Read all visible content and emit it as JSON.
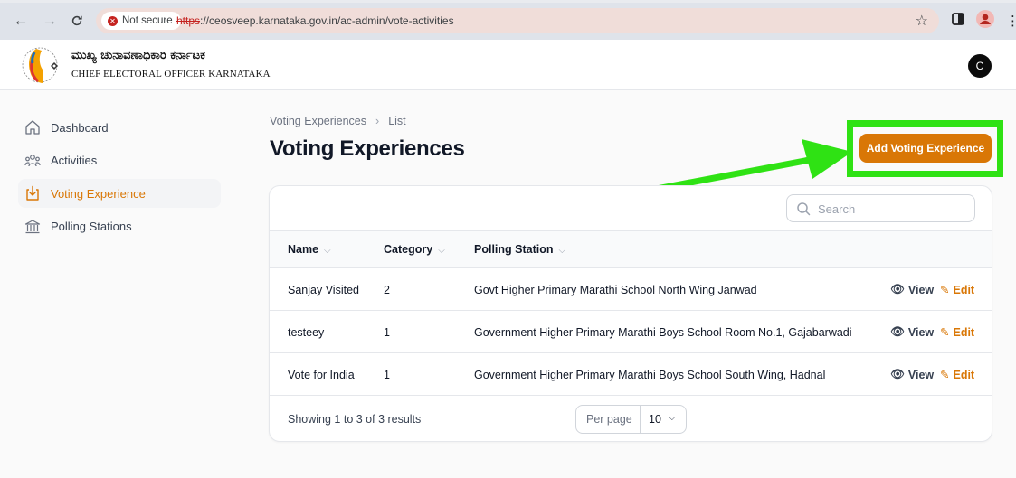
{
  "browser": {
    "security_chip": "Not secure",
    "url_protocol": "https",
    "url_rest": "://ceosveep.karnataka.gov.in/ac-admin/vote-activities",
    "icons": [
      "back-icon",
      "forward-icon",
      "reload-icon",
      "star-icon",
      "side-panel-icon",
      "profile-icon",
      "kebab-menu-icon"
    ]
  },
  "header": {
    "brand_kannada": "ಮುಖ್ಯ ಚುನಾವಣಾಧಿಕಾರಿ ಕರ್ನಾಟಕ",
    "brand_english": "CHIEF ELECTORAL OFFICER KARNATAKA",
    "avatar_initial": "C"
  },
  "sidebar": {
    "items": [
      {
        "label": "Dashboard",
        "icon": "home-icon",
        "active": false
      },
      {
        "label": "Activities",
        "icon": "users-icon",
        "active": false
      },
      {
        "label": "Voting Experience",
        "icon": "inbox-download-icon",
        "active": true
      },
      {
        "label": "Polling Stations",
        "icon": "building-icon",
        "active": false
      }
    ]
  },
  "page": {
    "breadcrumb": [
      "Voting Experiences",
      "List"
    ],
    "title": "Voting Experiences",
    "add_button": "Add Voting Experience"
  },
  "table": {
    "search_placeholder": "Search",
    "columns": [
      "Name",
      "Category",
      "Polling Station"
    ],
    "rows": [
      {
        "name": "Sanjay Visited",
        "category": "2",
        "polling_station": "Govt Higher Primary Marathi School North Wing Janwad"
      },
      {
        "name": "testeey",
        "category": "1",
        "polling_station": "Government Higher Primary Marathi Boys School Room No.1, Gajabarwadi"
      },
      {
        "name": "Vote for India",
        "category": "1",
        "polling_station": "Government Higher Primary Marathi Boys School South Wing, Hadnal"
      }
    ],
    "action_view": "View",
    "action_edit": "Edit",
    "footer_text": "Showing 1 to 3 of 3 results",
    "per_page_label": "Per page",
    "per_page_value": "10"
  },
  "colors": {
    "accent": "#d97706",
    "highlight_box": "#2fe214",
    "sidebar_active_bg": "#f3f4f6"
  }
}
